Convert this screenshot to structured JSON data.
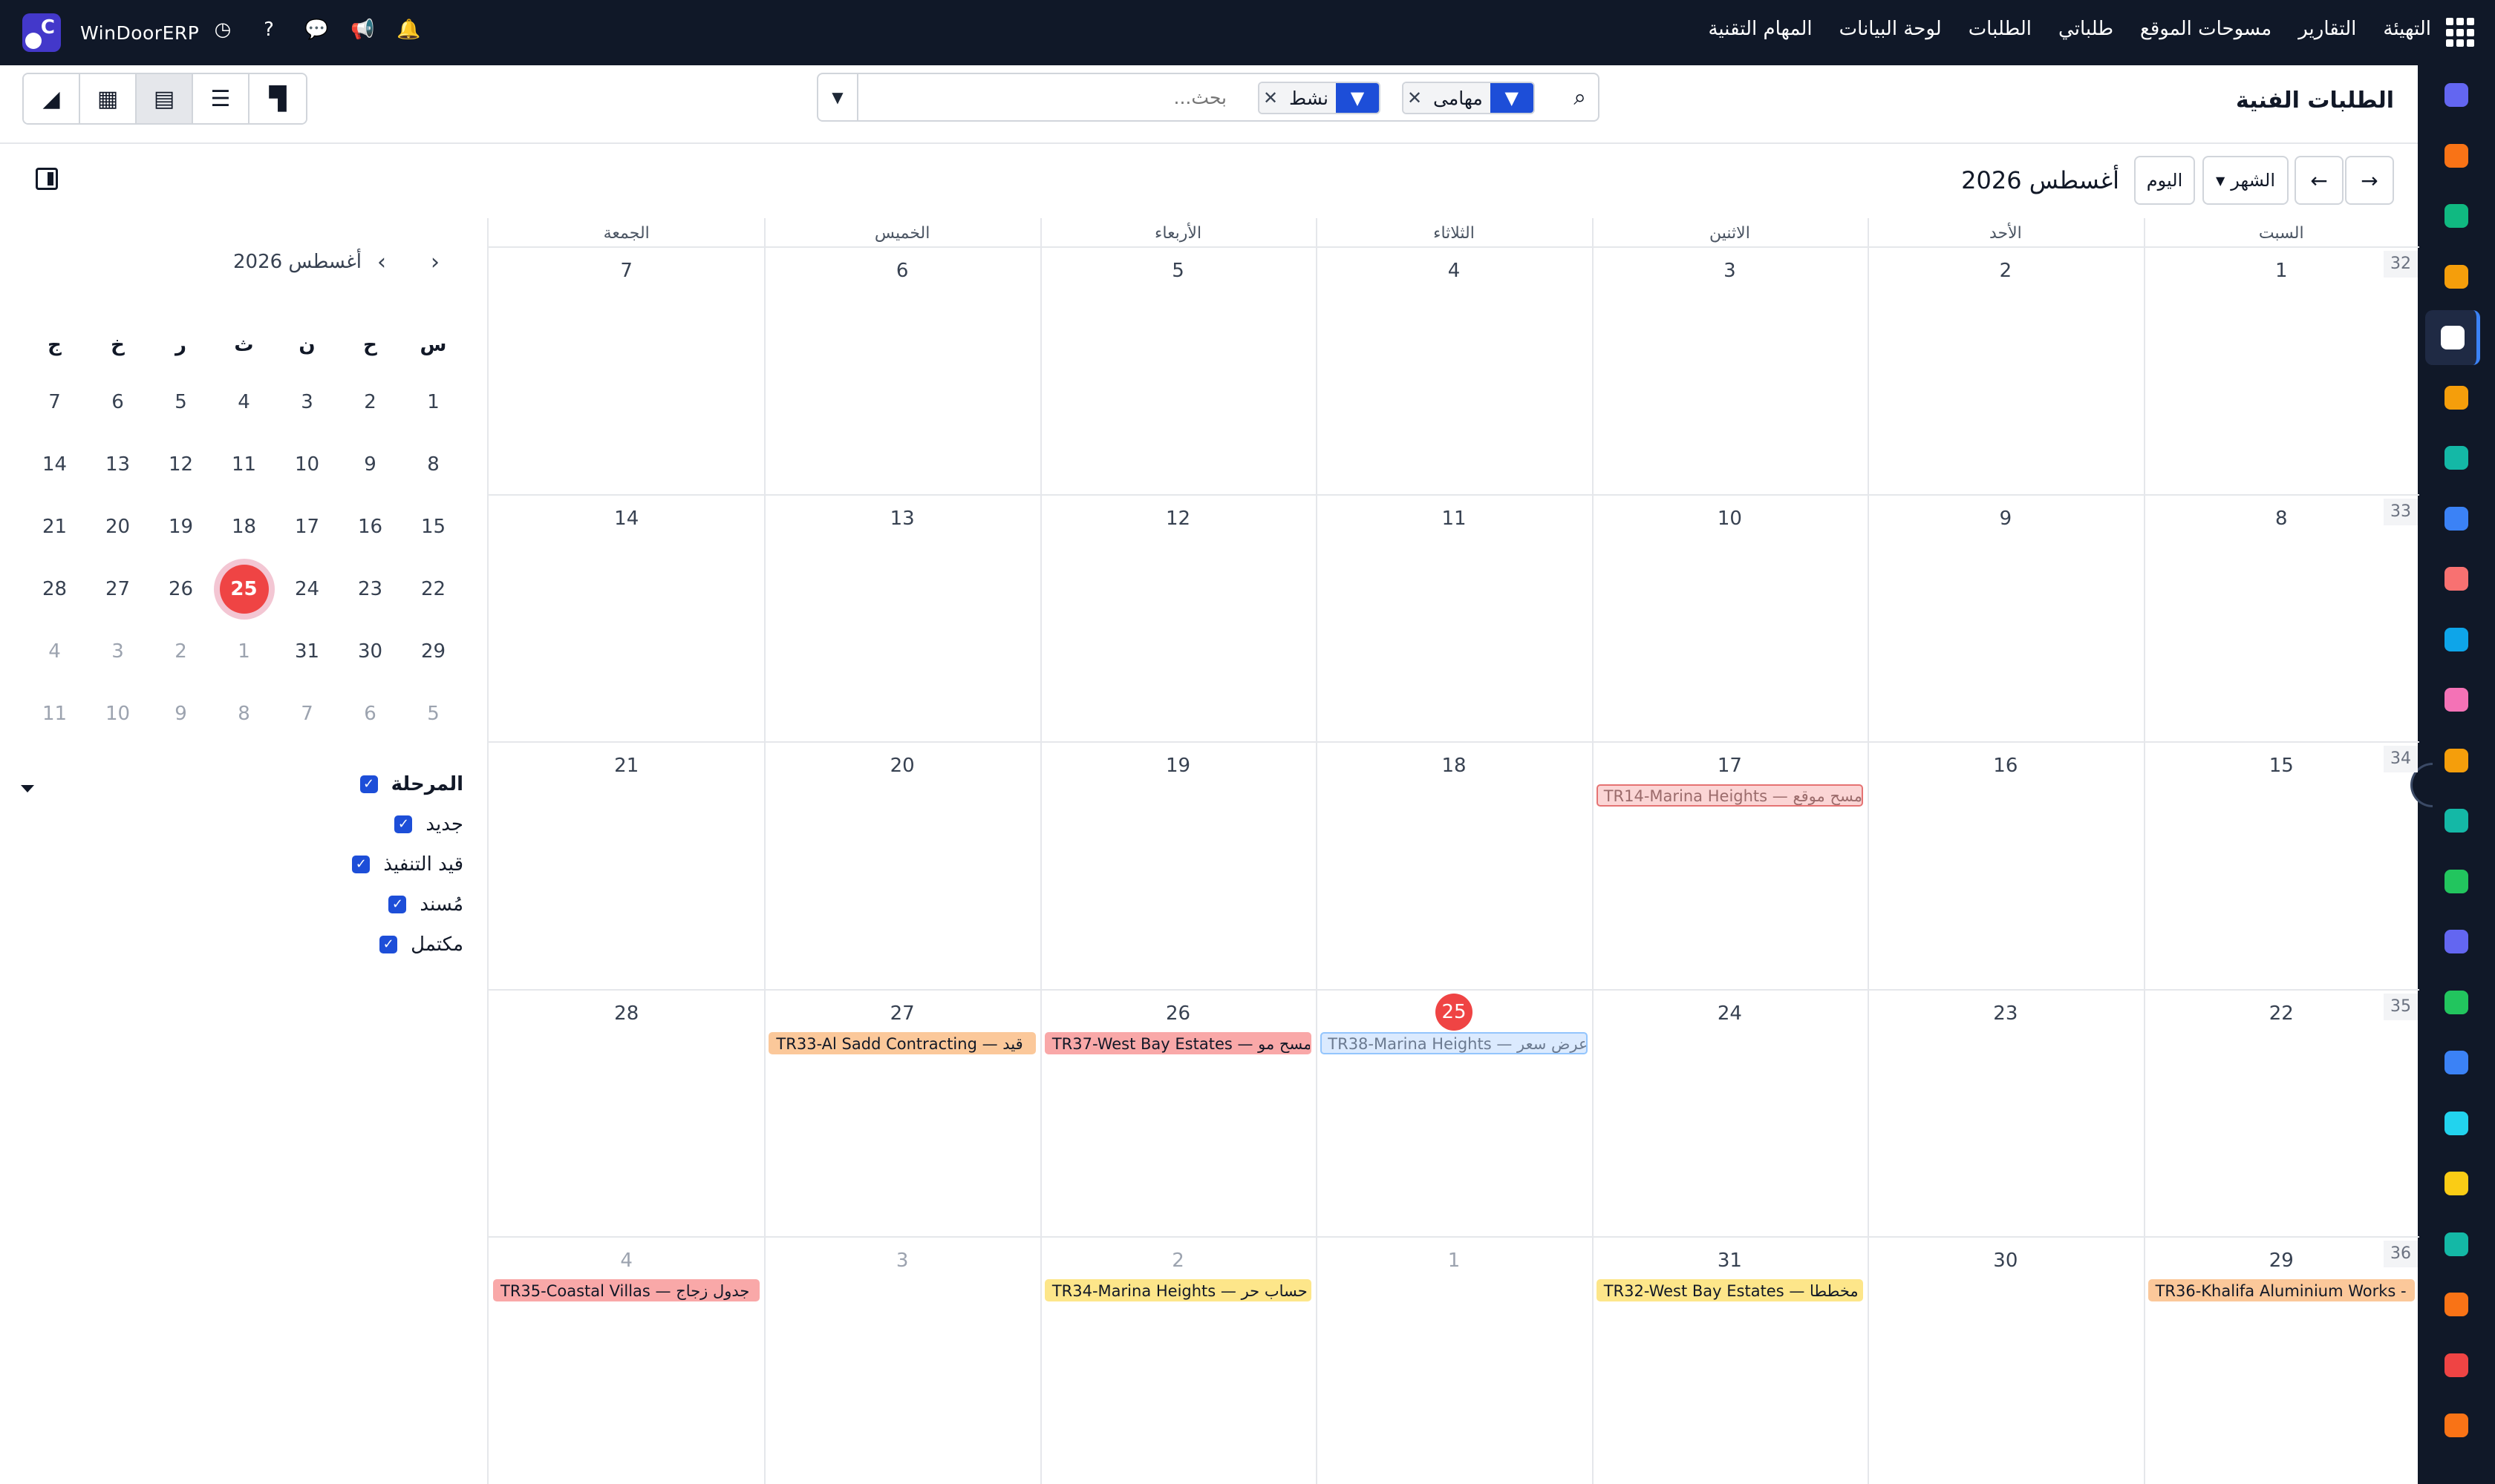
{
  "app": {
    "brand": "WinDoorERP",
    "logo_letter": "C",
    "menu": [
      "المهام التقنية",
      "لوحة البيانات",
      "الطلبات",
      "طلباتي",
      "مسوحات الموقع",
      "التقارير",
      "التهيئة"
    ],
    "sys_icons": [
      "bell-icon",
      "megaphone-icon",
      "chat-icon",
      "help-icon",
      "clock-icon"
    ]
  },
  "page": {
    "title": "الطلبات الفنية",
    "search_placeholder": "بحث...",
    "facets": [
      {
        "label": "مهامى",
        "icon": "filter-icon"
      },
      {
        "label": "نشط",
        "icon": "filter-icon"
      }
    ],
    "views": [
      "kanban-icon",
      "list-icon",
      "calendar-icon",
      "pivot-icon",
      "graph-icon"
    ],
    "active_view": "calendar-icon"
  },
  "calendar": {
    "period_title": "أغسطس 2026",
    "scale_label": "الشهر",
    "today_label": "اليوم",
    "weekdays": [
      "السبت",
      "الأحد",
      "الاثنين",
      "الثلاثاء",
      "الأربعاء",
      "الخميس",
      "الجمعة"
    ],
    "weeks": [
      {
        "num": "32",
        "days": [
          {
            "d": "1"
          },
          {
            "d": "2"
          },
          {
            "d": "3"
          },
          {
            "d": "4"
          },
          {
            "d": "5"
          },
          {
            "d": "6"
          },
          {
            "d": "7"
          }
        ]
      },
      {
        "num": "33",
        "days": [
          {
            "d": "8"
          },
          {
            "d": "9"
          },
          {
            "d": "10"
          },
          {
            "d": "11"
          },
          {
            "d": "12"
          },
          {
            "d": "13"
          },
          {
            "d": "14"
          }
        ]
      },
      {
        "num": "34",
        "days": [
          {
            "d": "15"
          },
          {
            "d": "16"
          },
          {
            "d": "17"
          },
          {
            "d": "18"
          },
          {
            "d": "19"
          },
          {
            "d": "20"
          },
          {
            "d": "21"
          }
        ]
      },
      {
        "num": "35",
        "days": [
          {
            "d": "22"
          },
          {
            "d": "23"
          },
          {
            "d": "24"
          },
          {
            "d": "25",
            "today": true
          },
          {
            "d": "26"
          },
          {
            "d": "27"
          },
          {
            "d": "28"
          }
        ]
      },
      {
        "num": "36",
        "days": [
          {
            "d": "29"
          },
          {
            "d": "30"
          },
          {
            "d": "31"
          },
          {
            "d": "1",
            "other": true
          },
          {
            "d": "2",
            "other": true
          },
          {
            "d": "3",
            "other": true
          },
          {
            "d": "4",
            "other": true
          }
        ]
      }
    ],
    "events": [
      {
        "week": 2,
        "col": 2,
        "text": "TR14-Marina Heights — مسح موقع",
        "bg": "#fbd5d5",
        "border": "#e57373",
        "color": "#9b6b6b"
      },
      {
        "week": 3,
        "col": 3,
        "text": "TR38-Marina Heights — عرض سعر",
        "bg": "#dbeafe",
        "border": "#93c5fd",
        "color": "#6b7a90"
      },
      {
        "week": 3,
        "col": 4,
        "text": "TR37-West Bay Estates — مسح مو",
        "bg": "#f9a8a8",
        "border": "#f9a8a8",
        "color": "#111827"
      },
      {
        "week": 3,
        "col": 5,
        "text": "TR33-Al Sadd Contracting — قيد",
        "bg": "#fbc89a",
        "border": "#fbc89a",
        "color": "#111827"
      },
      {
        "week": 4,
        "col": 0,
        "text": "TR36-Khalifa Aluminium Works -",
        "bg": "#fbc89a",
        "border": "#fbc89a",
        "color": "#111827"
      },
      {
        "week": 4,
        "col": 2,
        "text": "TR32-West Bay Estates — مخططا",
        "bg": "#fde68a",
        "border": "#fde68a",
        "color": "#111827"
      },
      {
        "week": 4,
        "col": 4,
        "text": "TR34-Marina Heights — حساب حر",
        "bg": "#fde68a",
        "border": "#fde68a",
        "color": "#111827"
      },
      {
        "week": 4,
        "col": 6,
        "text": "TR35-Coastal Villas — جدول زجاج",
        "bg": "#f9a8a8",
        "border": "#f9a8a8",
        "color": "#111827"
      }
    ]
  },
  "mini_calendar": {
    "title": "أغسطس 2026",
    "weekdays": [
      "س",
      "ح",
      "ن",
      "ث",
      "ر",
      "خ",
      "ج"
    ],
    "rows": [
      [
        {
          "d": "1"
        },
        {
          "d": "2"
        },
        {
          "d": "3"
        },
        {
          "d": "4"
        },
        {
          "d": "5"
        },
        {
          "d": "6"
        },
        {
          "d": "7"
        }
      ],
      [
        {
          "d": "8"
        },
        {
          "d": "9"
        },
        {
          "d": "10"
        },
        {
          "d": "11"
        },
        {
          "d": "12"
        },
        {
          "d": "13"
        },
        {
          "d": "14"
        }
      ],
      [
        {
          "d": "15"
        },
        {
          "d": "16"
        },
        {
          "d": "17"
        },
        {
          "d": "18"
        },
        {
          "d": "19"
        },
        {
          "d": "20"
        },
        {
          "d": "21"
        }
      ],
      [
        {
          "d": "22"
        },
        {
          "d": "23"
        },
        {
          "d": "24"
        },
        {
          "d": "25",
          "today": true
        },
        {
          "d": "26"
        },
        {
          "d": "27"
        },
        {
          "d": "28"
        }
      ],
      [
        {
          "d": "29"
        },
        {
          "d": "30"
        },
        {
          "d": "31"
        },
        {
          "d": "1",
          "other": true
        },
        {
          "d": "2",
          "other": true
        },
        {
          "d": "3",
          "other": true
        },
        {
          "d": "4",
          "other": true
        }
      ],
      [
        {
          "d": "5",
          "other": true
        },
        {
          "d": "6",
          "other": true
        },
        {
          "d": "7",
          "other": true
        },
        {
          "d": "8",
          "other": true
        },
        {
          "d": "9",
          "other": true
        },
        {
          "d": "10",
          "other": true
        },
        {
          "d": "11",
          "other": true
        }
      ]
    ]
  },
  "filters": {
    "group_label": "المرحلة",
    "items": [
      "جديد",
      "قيد التنفيذ",
      "مُسند",
      "مكتمل"
    ]
  },
  "rail_apps": [
    {
      "name": "gmail-icon",
      "color": "#6366f1"
    },
    {
      "name": "chat-bubble-icon",
      "color": "#f97316"
    },
    {
      "name": "inventory-icon",
      "color": "#10b981"
    },
    {
      "name": "chart-bars-icon",
      "color": "#f59e0b"
    },
    {
      "name": "box-icon",
      "color": "#ffffff"
    },
    {
      "name": "portrait-icon",
      "color": "#f59e0b"
    },
    {
      "name": "checkmark-icon",
      "color": "#14b8a6"
    },
    {
      "name": "book-icon",
      "color": "#3b82f6"
    },
    {
      "name": "package-icon",
      "color": "#f87171"
    },
    {
      "name": "invoice-icon",
      "color": "#0ea5e9"
    },
    {
      "name": "team-icon",
      "color": "#f472b6"
    },
    {
      "name": "calendar-31-icon",
      "color": "#f59e0b"
    },
    {
      "name": "sign-icon",
      "color": "#14b8a6"
    },
    {
      "name": "contacts-icon",
      "color": "#22c55e"
    },
    {
      "name": "dashboard-icon",
      "color": "#6366f1"
    },
    {
      "name": "whatsapp-icon",
      "color": "#22c55e"
    },
    {
      "name": "compass-icon",
      "color": "#3b82f6"
    },
    {
      "name": "wave-icon",
      "color": "#22d3ee"
    },
    {
      "name": "paper-plane-icon",
      "color": "#facc15"
    },
    {
      "name": "card-icon",
      "color": "#14b8a6"
    },
    {
      "name": "cube-icon",
      "color": "#f97316"
    },
    {
      "name": "pie-icon",
      "color": "#ef4444"
    },
    {
      "name": "hexagon-icon",
      "color": "#f97316"
    }
  ]
}
